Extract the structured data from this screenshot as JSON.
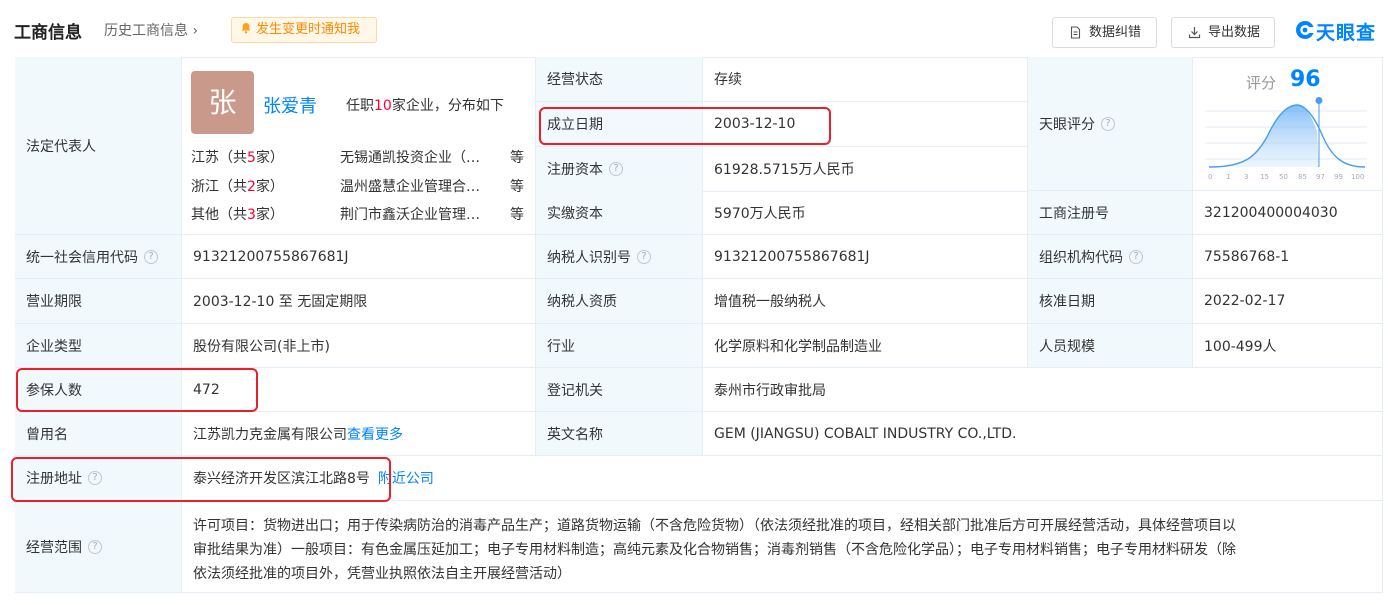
{
  "header": {
    "title": "工商信息",
    "history_link": "历史工商信息",
    "notify_label": "发生变更时通知我",
    "error_btn": "数据纠错",
    "export_btn": "导出数据",
    "logo_text": "天眼查"
  },
  "legal_rep": {
    "label": "法定代表人",
    "avatar_char": "张",
    "name": "张爱青",
    "desc_prefix": "任职",
    "desc_count": "10",
    "desc_suffix": "家企业，分布如下",
    "regions": [
      {
        "name_prefix": "江苏（共",
        "count": "5",
        "name_suffix": "家）",
        "company": "无锡通凯投资企业（…",
        "etc": "等"
      },
      {
        "name_prefix": "浙江（共",
        "count": "2",
        "name_suffix": "家）",
        "company": "温州盛慧企业管理合…",
        "etc": "等"
      },
      {
        "name_prefix": "其他（共",
        "count": "3",
        "name_suffix": "家）",
        "company": "荆门市鑫沃企业管理…",
        "etc": "等"
      }
    ]
  },
  "status": {
    "label": "经营状态",
    "value": "存续"
  },
  "founded": {
    "label": "成立日期",
    "value": "2003-12-10"
  },
  "reg_capital": {
    "label": "注册资本",
    "value": "61928.5715万人民币"
  },
  "paid_capital": {
    "label": "实缴资本",
    "value": "5970万人民币"
  },
  "score": {
    "label": "天眼评分",
    "score_word": "评分",
    "value": "96",
    "axis": [
      "0",
      "1",
      "3",
      "15",
      "50",
      "85",
      "97",
      "99",
      "100"
    ]
  },
  "biz_reg_no": {
    "label": "工商注册号",
    "value": "321200400004030"
  },
  "credit_code": {
    "label": "统一社会信用代码",
    "value": "91321200755867681J"
  },
  "taxpayer_id": {
    "label": "纳税人识别号",
    "value": "91321200755867681J"
  },
  "org_code": {
    "label": "组织机构代码",
    "value": "75586768-1"
  },
  "term": {
    "label": "营业期限",
    "value": "2003-12-10 至 无固定期限"
  },
  "taxpayer_type": {
    "label": "纳税人资质",
    "value": "增值税一般纳税人"
  },
  "approve_date": {
    "label": "核准日期",
    "value": "2022-02-17"
  },
  "company_type": {
    "label": "企业类型",
    "value": "股份有限公司(非上市)"
  },
  "industry": {
    "label": "行业",
    "value": "化学原料和化学制品制造业"
  },
  "staff_size": {
    "label": "人员规模",
    "value": "100-499人"
  },
  "insured": {
    "label": "参保人数",
    "value": "472"
  },
  "authority": {
    "label": "登记机关",
    "value": "泰州市行政审批局"
  },
  "former_name": {
    "label": "曾用名",
    "value": "江苏凯力克金属有限公司",
    "more": "查看更多"
  },
  "english_name": {
    "label": "英文名称",
    "value": "GEM (JIANGSU) COBALT INDUSTRY CO.,LTD."
  },
  "address": {
    "label": "注册地址",
    "value": "泰兴经济开发区滨江北路8号",
    "nearby": "附近公司"
  },
  "scope": {
    "label": "经营范围",
    "lines": [
      "许可项目：货物进出口；用于传染病防治的消毒产品生产；道路货物运输（不含危险货物）（依法须经批准的项目，经相关部门批准后方可开展经营活动，具体经营项目以",
      "审批结果为准）一般项目：有色金属压延加工；电子专用材料制造；高纯元素及化合物销售；消毒剂销售（不含危险化学品）；电子专用材料销售；电子专用材料研发（除",
      "依法须经批准的项目外，凭营业执照依法自主开展经营活动）"
    ]
  },
  "colors": {
    "accent": "#0084ff",
    "label_bg": "#f2f9fc",
    "highlight": "#e8202a",
    "notify": "#ff8a00"
  }
}
